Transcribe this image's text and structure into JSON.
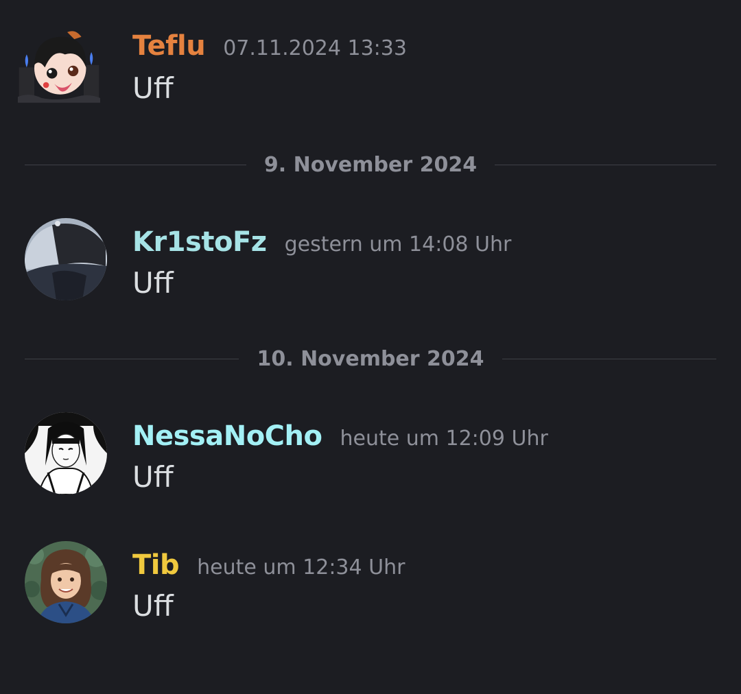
{
  "messages": [
    {
      "username": "Teflu",
      "timestamp": "07.11.2024 13:33",
      "content": "Uff",
      "name_color": "#e5823f"
    },
    {
      "username": "Kr1stoFz",
      "timestamp": "gestern um 14:08 Uhr",
      "content": "Uff",
      "name_color": "#a6e3e6"
    },
    {
      "username": "NessaNoCho",
      "timestamp": "heute um 12:09 Uhr",
      "content": "Uff",
      "name_color": "#a3f0f5"
    },
    {
      "username": "Tib",
      "timestamp": "heute um 12:34 Uhr",
      "content": "Uff",
      "name_color": "#f0c93e"
    }
  ],
  "dividers": [
    {
      "label": "9. November 2024"
    },
    {
      "label": "10. November 2024"
    }
  ],
  "colors": {
    "background": "#1c1d22",
    "timestamp": "#8e9099",
    "text": "#dbdee1",
    "divider_line": "#3f4147"
  }
}
